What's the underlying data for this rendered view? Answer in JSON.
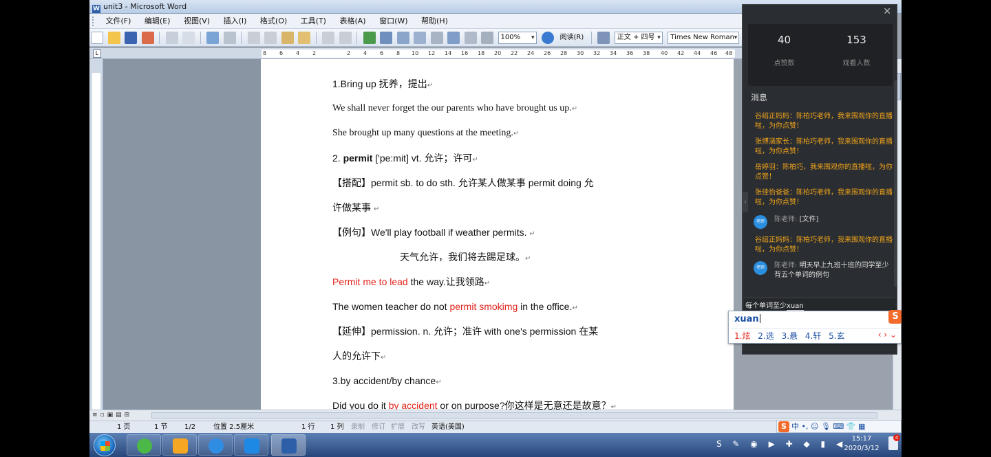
{
  "window": {
    "title": "unit3 - Microsoft Word",
    "app_icon": "word-icon"
  },
  "menu": [
    "文件(F)",
    "编辑(E)",
    "视图(V)",
    "插入(I)",
    "格式(O)",
    "工具(T)",
    "表格(A)",
    "窗口(W)",
    "帮助(H)"
  ],
  "toolbar": {
    "zoom": "100%",
    "read_label": "阅读(R)",
    "style": "正文 + 四号",
    "font": "Times New Roman",
    "size": "四号",
    "bold": "B"
  },
  "ruler": {
    "tab_selector": "L",
    "ticks": [
      "8",
      "6",
      "4",
      "2",
      "2",
      "4",
      "6",
      "8",
      "10",
      "12",
      "14",
      "16",
      "18",
      "20",
      "22",
      "24",
      "26",
      "28",
      "30",
      "32",
      "34",
      "36",
      "38",
      "40",
      "42",
      "44",
      "46",
      "48"
    ]
  },
  "document": {
    "l1": "1.Bring    up  抚养，提出",
    "l2": "We    shall never forget the our parents who have brought us up.",
    "l3": "She brought up    many questions at the meeting.",
    "l4_num": "2. ",
    "l4_word": "permit",
    "l4_rest": " ['pe:mit] vt.  允许；许可",
    "l5": "【搭配】permit sb. to do sth. 允许某人做某事      permit    doing 允",
    "l6": "许做某事  ",
    "l7": "【例句】We'll play football if weather permits.  ",
    "l8": "天气允许，我们将去踢足球。",
    "l9_red": "Permit    me to lead",
    "l9_rest": " the way.让我领路",
    "l10_a": "The women teacher do not ",
    "l10_red": "permit smokimg",
    "l10_b": " in the office.",
    "l11": "【延伸】permission.    n. 允许；准许    with one's permission    在某",
    "l12": "人的允许下",
    "l13": "3.by    accident/by chance",
    "l14_a": "Did you do it ",
    "l14_red": "by accident",
    "l14_b": " or on purpose?你这样是无意还是故意？",
    "para_mark": "↵"
  },
  "status": {
    "page": "1 页",
    "section": "1 节",
    "pages": "1/2",
    "position": "位置 2.5厘米",
    "line": "1 行",
    "column": "1 列",
    "rec": "录制",
    "trk": "修订",
    "ext": "扩展",
    "ovr": "改写",
    "language": "英语(美国)"
  },
  "live_panel": {
    "likes": "40",
    "likes_label": "点赞数",
    "viewers": "153",
    "viewers_label": "观看人数",
    "messages_title": "消息",
    "messages": [
      "谷绍正妈妈：陈柏巧老师，我来围观你的直播啦，为你点赞！",
      "张博涵家长：陈柏巧老师，我来围观你的直播啦，为你点赞！",
      "岳婷羽：陈柏巧，我来围观你的直播啦，为你点赞！",
      "张佳怡爸爸：陈柏巧老师，我来围观你的直播啦，为你点赞！",
      "谷绍正妈妈：陈柏巧老师，我来围观你的直播啦，为你点赞！"
    ],
    "teacher_avatar": "老师",
    "teacher_name": "陈老师:",
    "teacher_msg_1": "[文件]",
    "teacher_msg_2": "明天早上九班十班的同学至少背五个单词的例句",
    "input_text": "每个单词至少",
    "input_composing": "xuan"
  },
  "ime": {
    "pinyin": "xuan",
    "candidates": [
      "1.炫",
      "2.选",
      "3.悬",
      "4.轩",
      "5.玄"
    ],
    "nav": "‹ › ⌄",
    "logo": "S"
  },
  "imebar": {
    "logo": "S",
    "mode": "中",
    "items": "•, ☺ 🎙 ⌨ 👕 ▦"
  },
  "taskbar": {
    "time": "15:17",
    "date": "2020/3/12",
    "badge": "4"
  }
}
